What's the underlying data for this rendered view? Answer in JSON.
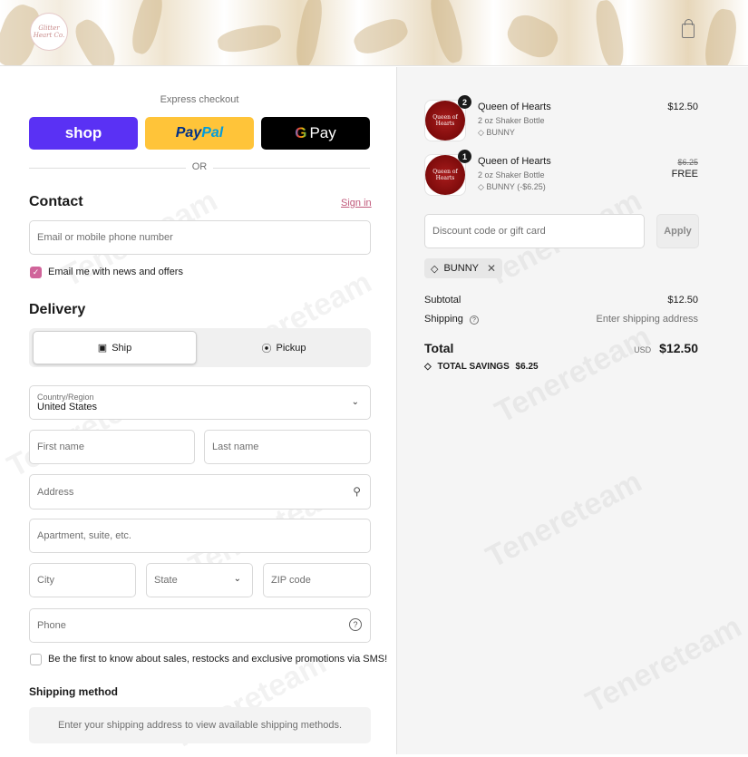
{
  "header": {
    "logo_text": "Glitter Heart Co.",
    "cart_icon": "shopping-bag-icon"
  },
  "express": {
    "title": "Express checkout",
    "shop_label": "shop",
    "paypal_label_a": "Pay",
    "paypal_label_b": "Pal",
    "gpay_g": "G",
    "gpay_label": "Pay",
    "or_text": "OR"
  },
  "contact": {
    "heading": "Contact",
    "signin_label": "Sign in",
    "email_placeholder": "Email or mobile phone number",
    "news_label": "Email me with news and offers",
    "news_checked": true
  },
  "delivery": {
    "heading": "Delivery",
    "ship_label": "Ship",
    "pickup_label": "Pickup",
    "country_label": "Country/Region",
    "country_value": "United States",
    "first_name": "First name",
    "last_name": "Last name",
    "address": "Address",
    "apartment": "Apartment, suite, etc.",
    "city": "City",
    "state": "State",
    "zip": "ZIP code",
    "phone": "Phone",
    "sms_label": "Be the first to know about sales, restocks and exclusive promotions via SMS!",
    "sms_checked": false
  },
  "shipping_method": {
    "heading": "Shipping method",
    "message": "Enter your shipping address to view available shipping methods."
  },
  "watermark": "Tenereteam",
  "order": {
    "items": [
      {
        "qty": "2",
        "image_text": "Queen of Hearts",
        "name": "Queen of Hearts",
        "variant": "2 oz Shaker Bottle",
        "tag": "BUNNY",
        "price": "$12.50",
        "original_price": ""
      },
      {
        "qty": "1",
        "image_text": "Queen of Hearts",
        "name": "Queen of Hearts",
        "variant": "2 oz Shaker Bottle",
        "tag": "BUNNY (-$6.25)",
        "price": "FREE",
        "original_price": "$6.25"
      }
    ],
    "discount_placeholder": "Discount code or gift card",
    "apply_label": "Apply",
    "applied_code": "BUNNY",
    "subtotal_label": "Subtotal",
    "subtotal_value": "$12.50",
    "shipping_label": "Shipping",
    "shipping_value": "Enter shipping address",
    "total_label": "Total",
    "currency": "USD",
    "total_value": "$12.50",
    "savings_label": "TOTAL SAVINGS",
    "savings_value": "$6.25"
  },
  "colors": {
    "shop_pay": "#5a31f4",
    "paypal": "#ffc439",
    "gpay": "#000000",
    "accent": "#c0587a",
    "checkbox": "#d0649a"
  }
}
